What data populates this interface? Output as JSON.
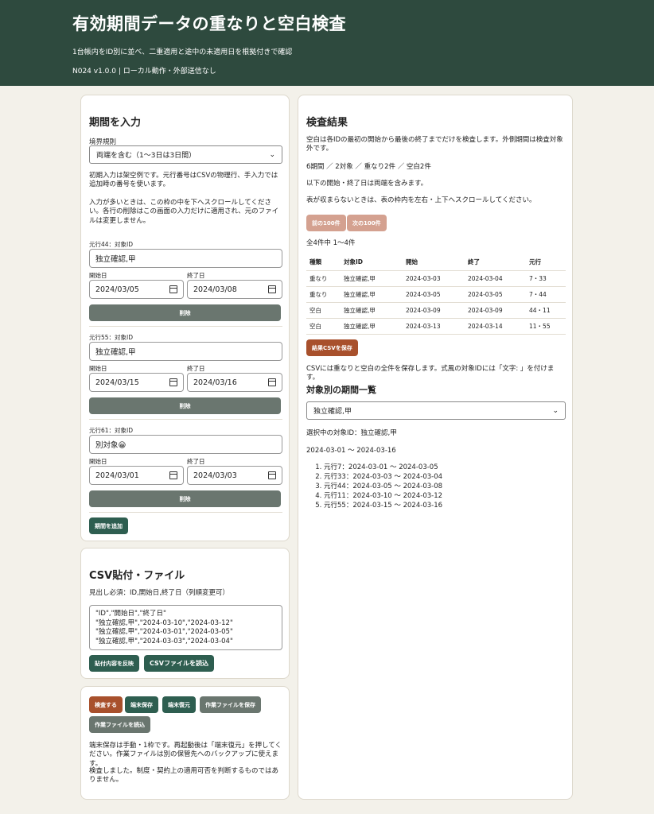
{
  "header": {
    "title": "有効期間データの重なりと空白検査",
    "subtitle": "1台帳内をID別に並べ、二重適用と途中の未適用日を根拠付きで確認",
    "version": "N024 v1.0.0 | ローカル動作・外部送信なし"
  },
  "input_panel": {
    "title": "期間を入力",
    "boundary_label": "境界規則",
    "boundary_value": "両端を含む（1〜3日は3日間）",
    "note1": "初期入力は架空例です。元行番号はCSVの物理行、手入力では追加時の番号を使います。",
    "note2": "入力が多いときは、この枠の中を下へスクロールしてください。各行の削除はこの画面の入力だけに適用され、元のファイルは変更しません。",
    "start_label": "開始日",
    "end_label": "終了日",
    "delete_label": "削除",
    "entries": [
      {
        "row_label": "元行44：対象ID",
        "id": "独立確認,甲",
        "start": "2024/03/05",
        "end": "2024/03/08"
      },
      {
        "row_label": "元行55：対象ID",
        "id": "独立確認,甲",
        "start": "2024/03/15",
        "end": "2024/03/16"
      },
      {
        "row_label": "元行61：対象ID",
        "id": "別対象😀",
        "start": "2024/03/01",
        "end": "2024/03/03"
      }
    ],
    "add_label": "期間を追加"
  },
  "csv_panel": {
    "title": "CSV貼付・ファイル",
    "note": "見出し必須：ID,開始日,終了日（列順変更可）",
    "textarea_lines": [
      "\"ID\",\"開始日\",\"終了日\"",
      "\"独立確認,甲\",\"2024-03-10\",\"2024-03-12\"",
      "\"独立確認,甲\",\"2024-03-01\",\"2024-03-05\"",
      "\"独立確認,甲\",\"2024-03-03\",\"2024-03-04\""
    ],
    "apply_label": "貼付内容を反映",
    "load_label": "CSVファイルを読込"
  },
  "action_panel": {
    "check_label": "検査する",
    "save_local_label": "端末保存",
    "restore_label": "端末復元",
    "save_work_label": "作業ファイルを保存",
    "load_work_label": "作業ファイルを読込",
    "note1": "端末保存は手動・1枠です。再起動後は「端末復元」を押してください。作業ファイルは別の保管先へのバックアップに使えます。",
    "note2": "検査しました。制度・契約上の適用可否を判断するものではありません。"
  },
  "result_panel": {
    "title": "検査結果",
    "desc": "空白は各IDの最初の開始から最後の終了までだけを検査します。外側期間は検査対象外です。",
    "summary": "6期間 ／ 2対象 ／ 重なり2件 ／ 空白2件",
    "inclusive": "以下の開始・終了日は両端を含みます。",
    "scroll_hint": "表が収まらないときは、表の枠内を左右・上下へスクロールしてください。",
    "prev_label": "前の100件",
    "next_label": "次の100件",
    "count": "全4件中 1〜4件",
    "columns": [
      "種類",
      "対象ID",
      "開始",
      "終了",
      "元行"
    ],
    "rows": [
      [
        "重なり",
        "独立確認,甲",
        "2024-03-03",
        "2024-03-04",
        "7・33"
      ],
      [
        "重なり",
        "独立確認,甲",
        "2024-03-05",
        "2024-03-05",
        "7・44"
      ],
      [
        "空白",
        "独立確認,甲",
        "2024-03-09",
        "2024-03-09",
        "44・11"
      ],
      [
        "空白",
        "独立確認,甲",
        "2024-03-13",
        "2024-03-14",
        "11・55"
      ]
    ],
    "save_csv_label": "結果CSVを保存",
    "csv_note": "CSVには重なりと空白の全件を保存します。式風の対象IDには「文字: 」を付けます。",
    "list_title": "対象別の期間一覧",
    "selected_option": "独立確認,甲",
    "selected_text": "選択中の対象ID：独立確認,甲",
    "range_text": "2024-03-01 〜 2024-03-16",
    "periods": [
      "元行7：2024-03-01 〜 2024-03-05",
      "元行33：2024-03-03 〜 2024-03-04",
      "元行44：2024-03-05 〜 2024-03-08",
      "元行11：2024-03-10 〜 2024-03-12",
      "元行55：2024-03-15 〜 2024-03-16"
    ]
  },
  "colors": {
    "header_bg": "#2e4a3e",
    "button_green": "#2e5e50",
    "button_gray": "#6a766f",
    "button_rust": "#a8502c",
    "button_disabled": "#d4a190",
    "page_bg": "#f3f1ea"
  }
}
